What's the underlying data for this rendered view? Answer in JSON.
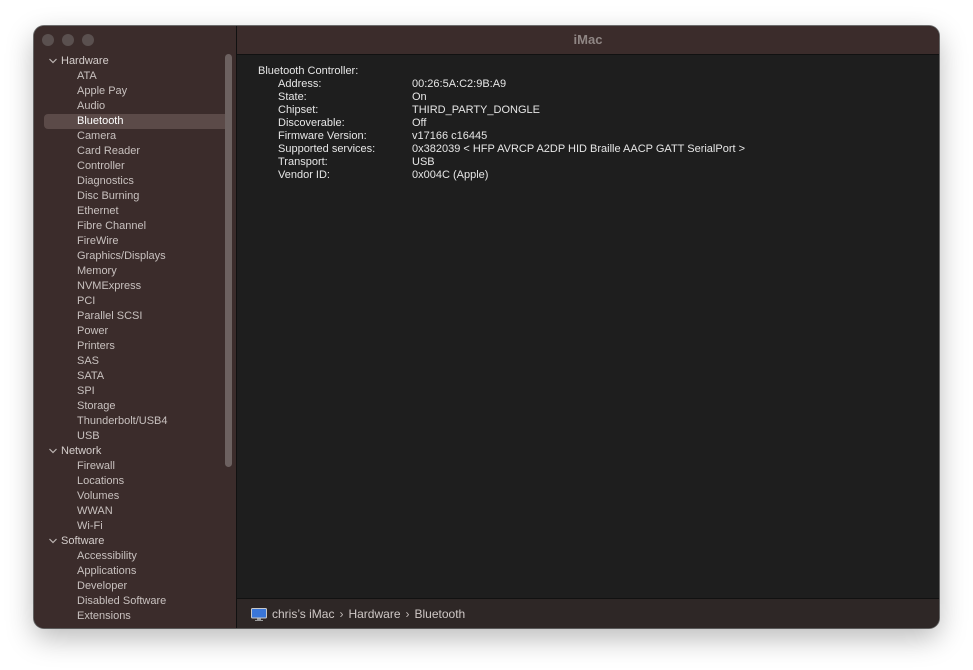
{
  "window": {
    "title": "iMac"
  },
  "sidebar": {
    "groups": [
      {
        "label": "Hardware",
        "items": [
          "ATA",
          "Apple Pay",
          "Audio",
          "Bluetooth",
          "Camera",
          "Card Reader",
          "Controller",
          "Diagnostics",
          "Disc Burning",
          "Ethernet",
          "Fibre Channel",
          "FireWire",
          "Graphics/Displays",
          "Memory",
          "NVMExpress",
          "PCI",
          "Parallel SCSI",
          "Power",
          "Printers",
          "SAS",
          "SATA",
          "SPI",
          "Storage",
          "Thunderbolt/USB4",
          "USB"
        ]
      },
      {
        "label": "Network",
        "items": [
          "Firewall",
          "Locations",
          "Volumes",
          "WWAN",
          "Wi-Fi"
        ]
      },
      {
        "label": "Software",
        "items": [
          "Accessibility",
          "Applications",
          "Developer",
          "Disabled Software",
          "Extensions"
        ]
      }
    ],
    "selected": "Bluetooth"
  },
  "detail": {
    "heading": "Bluetooth Controller:",
    "rows": [
      {
        "key": "Address:",
        "value": "00:26:5A:C2:9B:A9"
      },
      {
        "key": "State:",
        "value": "On"
      },
      {
        "key": "Chipset:",
        "value": "THIRD_PARTY_DONGLE"
      },
      {
        "key": "Discoverable:",
        "value": "Off"
      },
      {
        "key": "Firmware Version:",
        "value": "v17166 c16445"
      },
      {
        "key": "Supported services:",
        "value": "0x382039 < HFP AVRCP A2DP HID Braille AACP GATT SerialPort >"
      },
      {
        "key": "Transport:",
        "value": "USB"
      },
      {
        "key": "Vendor ID:",
        "value": "0x004C (Apple)"
      }
    ]
  },
  "breadcrumb": [
    "chris’s iMac",
    "Hardware",
    "Bluetooth"
  ],
  "colors": {
    "sidebar_bg": "#3b2c2b",
    "content_bg": "#1e1e1e",
    "selection": "#5b4a48"
  }
}
